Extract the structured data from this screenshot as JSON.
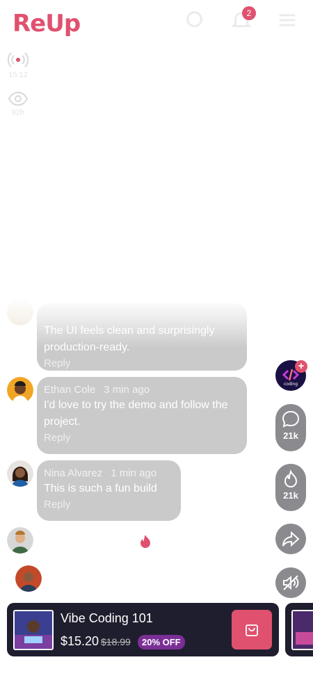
{
  "app": {
    "logo_text": "ReUp",
    "notification_count": "2",
    "colors": {
      "brand": "#e0516f",
      "bubble": "#cacaca",
      "action_pill": "#8a8a8f",
      "product_card": "#1f1e2e",
      "discount": "#7b2f96"
    }
  },
  "live": {
    "duration": "15:12",
    "duration_icon": "live-broadcast-icon",
    "viewers": "92h",
    "viewers_icon": "eye-icon"
  },
  "comments": [
    {
      "author": "",
      "time": "",
      "text": "The UI feels clean and surprisingly production-ready.",
      "reply": "Reply"
    },
    {
      "author": "Ethan Cole",
      "time": "3 min ago",
      "text": "I'd love to try the demo and follow the project.",
      "reply": "Reply"
    },
    {
      "author": "Nina Alvarez",
      "time": "1 min ago",
      "text": "This is such a fun build",
      "reply": "Reply"
    }
  ],
  "actions": {
    "channel_logo_text": "coding",
    "follow_icon": "plus-icon",
    "comments_count": "21k",
    "comments_icon": "chat-bubble-icon",
    "likes_count": "21k",
    "likes_icon": "flame-icon",
    "share_icon": "share-arrow-icon",
    "mute_icon": "speaker-off-icon"
  },
  "product": {
    "name": "Vibe Coding 101",
    "price": "$15.20",
    "old_price": "$18.99",
    "discount": "20% OFF",
    "cart_icon": "shopping-bag-icon"
  }
}
